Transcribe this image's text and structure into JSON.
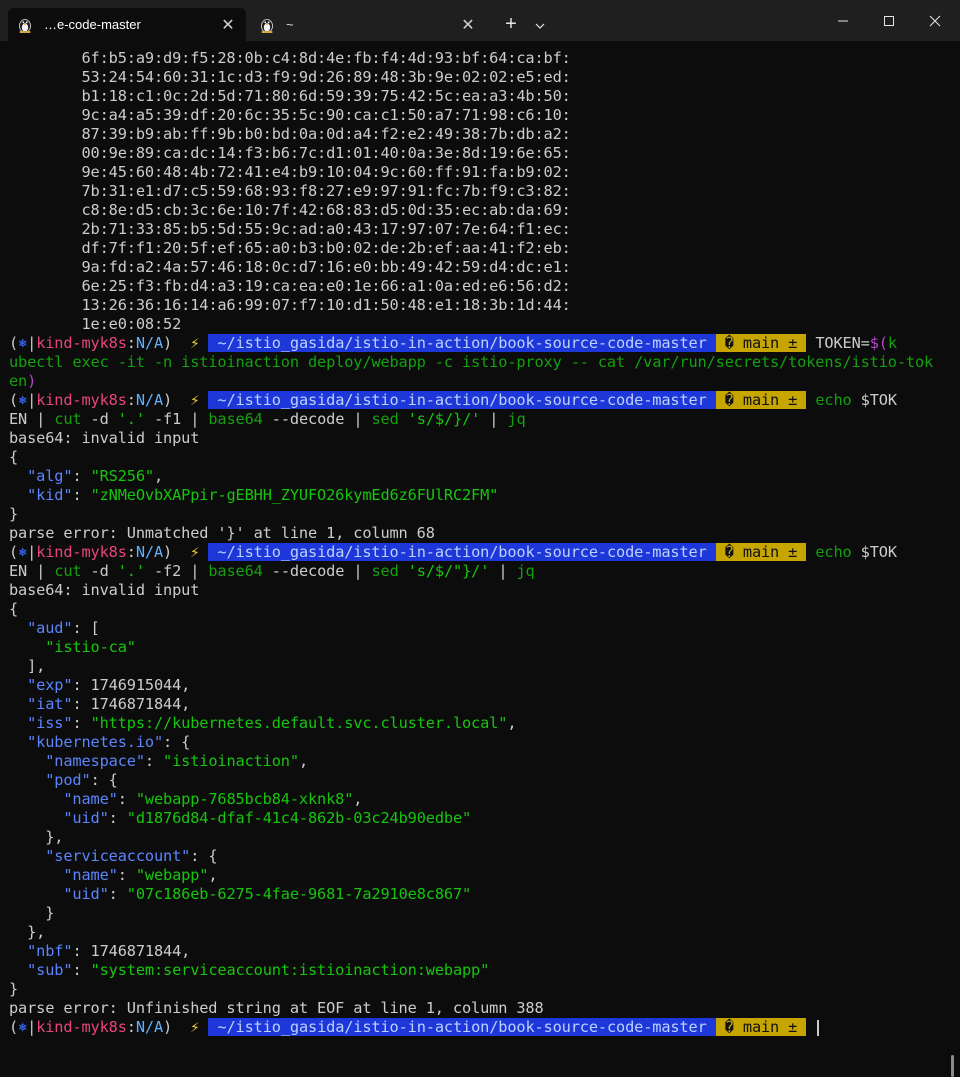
{
  "tabs": [
    {
      "label": "…e-code-master",
      "icon": "linux-tux-icon",
      "active": true
    },
    {
      "label": "~",
      "icon": "linux-tux-icon",
      "active": false
    }
  ],
  "controls": {
    "new_tab": "+",
    "dropdown": "⌄"
  },
  "prompt": {
    "open": "(",
    "k8s_icon": "⎈",
    "bar": "|",
    "context": "kind-myk8s",
    "colon": ":",
    "namespace": "N/A",
    "close": ")",
    "bolt": "⚡",
    "path": " ~/istio_gasida/istio-in-action/book-source-code-master ",
    "git_branch": " � main ± ",
    "separator": ""
  },
  "hex_lines": [
    "6f:b5:a9:d9:f5:28:0b:c4:8d:4e:fb:f4:4d:93:bf:64:ca:bf:",
    "53:24:54:60:31:1c:d3:f9:9d:26:89:48:3b:9e:02:02:e5:ed:",
    "b1:18:c1:0c:2d:5d:71:80:6d:59:39:75:42:5c:ea:a3:4b:50:",
    "9c:a4:a5:39:df:20:6c:35:5c:90:ca:c1:50:a7:71:98:c6:10:",
    "87:39:b9:ab:ff:9b:b0:bd:0a:0d:a4:f2:e2:49:38:7b:db:a2:",
    "00:9e:89:ca:dc:14:f3:b6:7c:d1:01:40:0a:3e:8d:19:6e:65:",
    "9e:45:60:48:4b:72:41:e4:b9:10:04:9c:60:ff:91:fa:b9:02:",
    "7b:31:e1:d7:c5:59:68:93:f8:27:e9:97:91:fc:7b:f9:c3:82:",
    "c8:8e:d5:cb:3c:6e:10:7f:42:68:83:d5:0d:35:ec:ab:da:69:",
    "2b:71:33:85:b5:5d:55:9c:ad:a0:43:17:97:07:7e:64:f1:ec:",
    "df:7f:f1:20:5f:ef:65:a0:b3:b0:02:de:2b:ef:aa:41:f2:eb:",
    "9a:fd:a2:4a:57:46:18:0c:d7:16:e0:bb:49:42:59:d4:dc:e1:",
    "6e:25:f3:fb:d4:a3:19:ca:ea:e0:1e:66:a1:0a:ed:e6:56:d2:",
    "13:26:36:16:14:a6:99:07:f7:10:d1:50:48:e1:18:3b:1d:44:",
    "1e:e0:08:52"
  ],
  "cmd1": {
    "start": " TOKEN=",
    "sub_open": "$(",
    "wrap1": "k",
    "line2": "ubectl exec -it -n istioinaction deploy/webapp -c istio-proxy -- cat /var/run/secrets/tokens/istio-tok",
    "line3a": "en",
    "line3b": ")"
  },
  "cmd2": {
    "echo": " echo",
    "var_a": " $TOK",
    "var_b": "EN",
    "pipe1": " | ",
    "cut": "cut",
    "cut_args_a": " -d ",
    "cut_delim": "'.'",
    "cut_args_b": " -f1",
    "pipe2": " | ",
    "base64": "base64",
    "base64_args": " --decode",
    "pipe3": " | ",
    "sed": "sed",
    "sed_space": " ",
    "sed_expr": "'s/$/}/'",
    "pipe4": " | ",
    "jq": "jq"
  },
  "out2": {
    "err1": "base64: invalid input",
    "open": "{",
    "ind": "  ",
    "k_alg": "\"alg\"",
    "c1": ": ",
    "v_alg": "\"RS256\"",
    "comma": ",",
    "k_kid": "\"kid\"",
    "c2": ": ",
    "v_kid": "\"zNMeOvbXAPpir-gEBHH_ZYUFO26kymEd6z6FUlRC2FM\"",
    "close": "}",
    "err2": "parse error: Unmatched '}' at line 1, column 68"
  },
  "cmd3": {
    "echo": " echo",
    "var_a": " $TOK",
    "var_b": "EN",
    "pipe1": " | ",
    "cut": "cut",
    "cut_args_a": " -d ",
    "cut_delim": "'.'",
    "cut_args_b": " -f2",
    "pipe2": " | ",
    "base64": "base64",
    "base64_args": " --decode",
    "pipe3": " | ",
    "sed": "sed",
    "sed_space": " ",
    "sed_expr": "'s/$/\"}/'",
    "pipe4": " | ",
    "jq": "jq"
  },
  "out3": {
    "err1": "base64: invalid input",
    "open": "{",
    "i1": "  ",
    "i2": "    ",
    "i3": "      ",
    "k_aud": "\"aud\"",
    "aud_tail": ": [",
    "v_aud": "\"istio-ca\"",
    "aud_close": "],",
    "k_exp": "\"exp\"",
    "v_exp": ": 1746915044,",
    "k_iat": "\"iat\"",
    "v_iat": ": 1746871844,",
    "k_iss": "\"iss\"",
    "sep": ": ",
    "v_iss": "\"https://kubernetes.default.svc.cluster.local\"",
    "comma": ",",
    "k_kio": "\"kubernetes.io\"",
    "obj_open": ": {",
    "k_namespace": "\"namespace\"",
    "v_namespace": "\"istioinaction\"",
    "k_pod": "\"pod\"",
    "k_name": "\"name\"",
    "v_pod_name": "\"webapp-7685bcb84-xknk8\"",
    "k_uid": "\"uid\"",
    "v_pod_uid": "\"d1876d84-dfaf-41c4-862b-03c24b90edbe\"",
    "obj_close_comma": "},",
    "obj_close": "}",
    "k_sa": "\"serviceaccount\"",
    "v_sa_name": "\"webapp\"",
    "v_sa_uid": "\"07c186eb-6275-4fae-9681-7a2910e8c867\"",
    "k_nbf": "\"nbf\"",
    "v_nbf": ": 1746871844,",
    "k_sub": "\"sub\"",
    "v_sub": "\"system:serviceaccount:istioinaction:webapp\"",
    "close": "}",
    "err2": "parse error: Unfinished string at EOF at line 1, column 388"
  }
}
